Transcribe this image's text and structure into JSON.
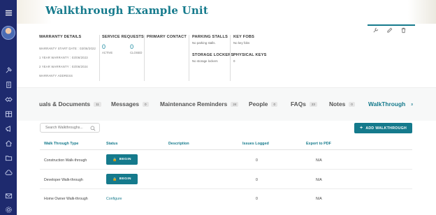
{
  "title": "Walkthrough Example Unit",
  "warranty": {
    "heading": "WARRANTY DETAILS",
    "start": "WARRANTY START DATE : 03/06/2022",
    "one_year": "1 YEAR WARRANTY : 03/06/2023",
    "two_year": "2 YEAR WARRANTY : 03/06/2024",
    "address": "WARRANTY ADDRESS"
  },
  "service_requests": {
    "heading": "SERVICE REQUESTS",
    "active_count": "0",
    "active_label": "ACTIVE",
    "closed_count": "0",
    "closed_label": "CLOSED"
  },
  "primary_contact": {
    "heading": "PRIMARY CONTACT"
  },
  "parking": {
    "heading": "PARKING STALLS",
    "value": "No parking stalls."
  },
  "storage": {
    "heading": "STORAGE LOCKERS",
    "value": "No storage lockers"
  },
  "key_fobs": {
    "heading": "KEY FOBS",
    "value": "No key fobs"
  },
  "physical_keys": {
    "heading": "PHYSICAL KEYS",
    "value": "0"
  },
  "tabs": [
    {
      "label": "uals & Documents",
      "count": "11"
    },
    {
      "label": "Messages",
      "count": "0"
    },
    {
      "label": "Maintenance Reminders",
      "count": "24"
    },
    {
      "label": "People",
      "count": "0"
    },
    {
      "label": "FAQs",
      "count": "23"
    },
    {
      "label": "Notes",
      "count": "0"
    },
    {
      "label": "WalkThrough",
      "count": "3"
    }
  ],
  "search": {
    "placeholder": "Search Walkthroughs..."
  },
  "add_button": "ADD WALKTHROUGH",
  "table": {
    "headers": [
      "Walk Through Type",
      "Status",
      "Description",
      "Issues Logged",
      "Export to PDF"
    ],
    "rows": [
      {
        "type": "Construction Walk-through",
        "status": "BEGIN",
        "description": "",
        "issues": "0",
        "export": "N/A"
      },
      {
        "type": "Developer Walk-through",
        "status": "BEGIN",
        "description": "",
        "issues": "0",
        "export": "N/A"
      },
      {
        "type": "Home Owner Walk-through",
        "status": "Configure",
        "description": "",
        "issues": "0",
        "export": "N/A"
      }
    ]
  },
  "icons": {
    "sidebar": [
      "menu-icon",
      "user-avatar",
      "hammer-icon",
      "building-icon",
      "handshake-icon",
      "table-icon",
      "megaphone-icon",
      "home-icon",
      "folder-icon",
      "cloud-icon",
      "mail-icon",
      "settings-icon"
    ],
    "actions": [
      "wrench-icon",
      "edit-icon",
      "trash-icon"
    ]
  },
  "colors": {
    "sidebar": "#1e2a6e",
    "accent": "#157a8c"
  }
}
